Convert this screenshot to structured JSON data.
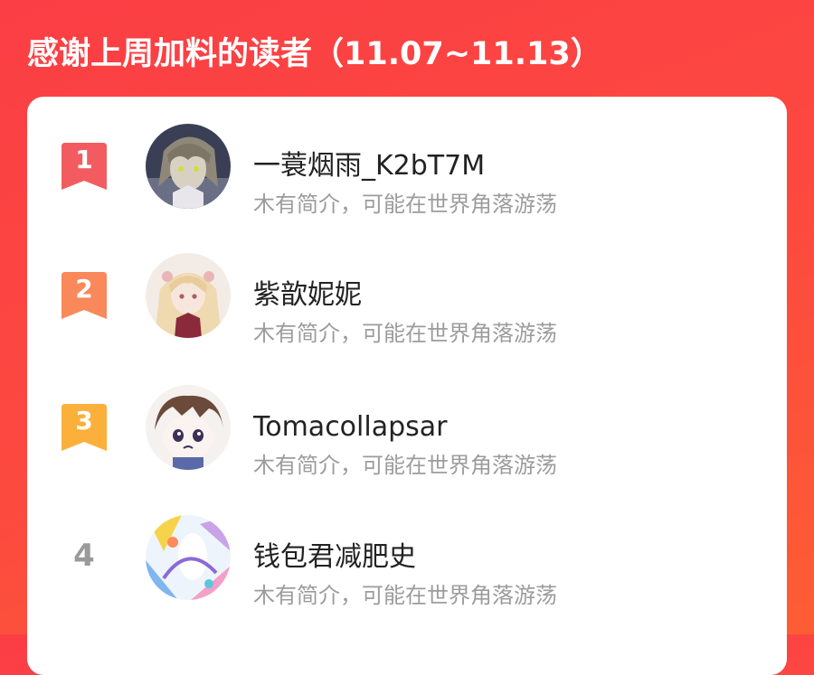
{
  "header": {
    "title": "感谢上周加料的读者（11.07~11.13）"
  },
  "colors": {
    "rank_1": "#f25c61",
    "rank_2": "#f9885a",
    "rank_3": "#fbb03b",
    "rank_plain": "#9a9a9a"
  },
  "readers": [
    {
      "rank": "1",
      "name": "一蓑烟雨_K2bT7M",
      "intro": "木有简介，可能在世界角落游荡",
      "avatar": "anime-boy-avatar"
    },
    {
      "rank": "2",
      "name": "紫歆妮妮",
      "intro": "木有简介，可能在世界角落游荡",
      "avatar": "anime-girl-avatar"
    },
    {
      "rank": "3",
      "name": "Tomacollapsar",
      "intro": "木有简介，可能在世界角落游荡",
      "avatar": "chibi-avatar"
    },
    {
      "rank": "4",
      "name": "钱包君减肥史",
      "intro": "木有简介，可能在世界角落游荡",
      "avatar": "colorful-art-avatar"
    }
  ]
}
